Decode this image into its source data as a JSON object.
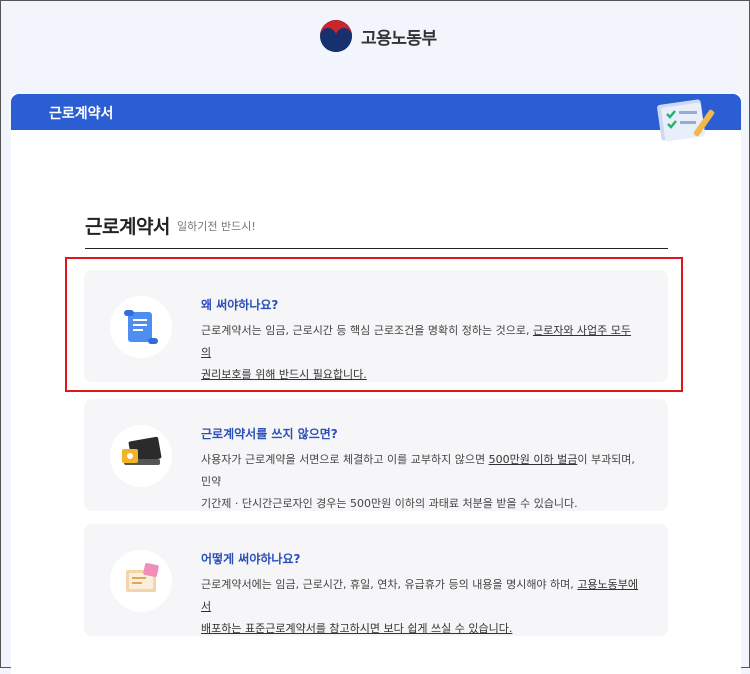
{
  "site": {
    "logo_text": "고용노동부",
    "logo_icon": "taegeuk-icon"
  },
  "panel": {
    "title": "근로계약서"
  },
  "section": {
    "title": "근로계약서",
    "subtitle": "일하기전 반드시!"
  },
  "cards": [
    {
      "icon": "scroll-document-icon",
      "heading": "왜 써야하나요?",
      "body_line1_plain": "근로계약서는 임금, 근로시간 등 핵심 근로조건을 명확히 정하는 것으로, ",
      "body_line1_underline": "근로자와 사업주 모두의",
      "body_line2_underline": "권리보호를 위해 반드시 필요합니다."
    },
    {
      "icon": "laptop-wallet-icon",
      "heading": "근로계약서를 쓰지 않으면?",
      "body_line1_plain": "사용자가 근로계약을 서면으로 체결하고 이를 교부하지 않으면 ",
      "body_line1_underline": "500만원 이하 벌금",
      "body_line1_tail": "이 부과되며, 민약",
      "body_line2_plain": "기간제 · 단시간근로자인 경우는 500만원 이하의 과태료 처분을 받을 수 있습니다."
    },
    {
      "icon": "document-stack-icon",
      "heading": "어떻게 써야하나요?",
      "body_line1_plain": "근로계약서에는 임금, 근로시간, 휴일, 연차, 유급휴가 등의 내용을 명시해야 하며, ",
      "body_line1_underline": "고용노동부에서",
      "body_line2_underline": "배포하는 표준근로계약서를 참고하시면 보다 쉽게 쓰실 수 있습니다."
    }
  ],
  "colors": {
    "header_blue": "#2c5ed3",
    "heading_blue": "#2a4fb8",
    "highlight_red": "#e0161c"
  }
}
